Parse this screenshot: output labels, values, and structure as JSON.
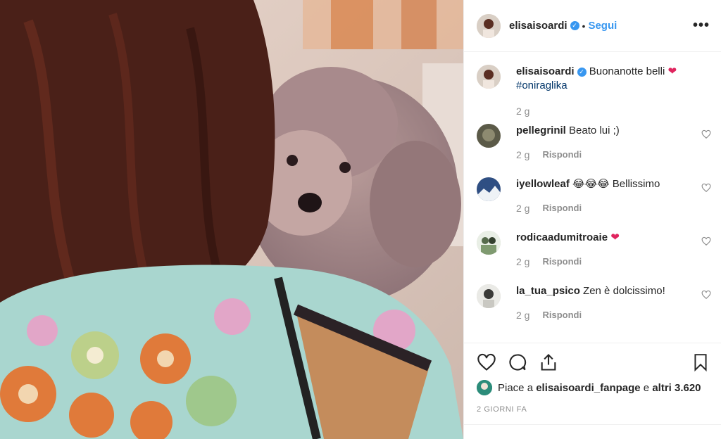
{
  "post": {
    "author": "elisaisoardi",
    "verified_mark": "✓",
    "dot": "•",
    "follow_label": "Segui",
    "more_label": "•••"
  },
  "caption": {
    "username": "elisaisoardi",
    "text": "Buonanotte belli",
    "emoji": "❤",
    "hashtag": "#oniraglika",
    "age": "2 g"
  },
  "comments": [
    {
      "username": "pellegrinil",
      "text": "Beato lui ;)",
      "age": "2 g",
      "reply": "Rispondi"
    },
    {
      "username": "iyellowleaf",
      "text": "😂😂😂 Bellissimo",
      "age": "2 g",
      "reply": "Rispondi"
    },
    {
      "username": "rodicaadumitroaie",
      "text": "❤",
      "age": "2 g",
      "reply": "Rispondi"
    },
    {
      "username": "la_tua_psico",
      "text": "Zen è dolcissimo!",
      "age": "2 g",
      "reply": "Rispondi"
    }
  ],
  "likes": {
    "prefix": "Piace a",
    "user": "elisaisoardi_fanpage",
    "middle": "e",
    "others": "altri 3.620"
  },
  "timestamp": "2 GIORNI FA",
  "colors": {
    "accent": "#3897f0",
    "heart": "#e0245e",
    "muted": "#8e8e8e"
  },
  "icons": [
    "heart-icon",
    "comment-icon",
    "share-icon",
    "bookmark-icon",
    "verified-icon",
    "more-icon"
  ]
}
